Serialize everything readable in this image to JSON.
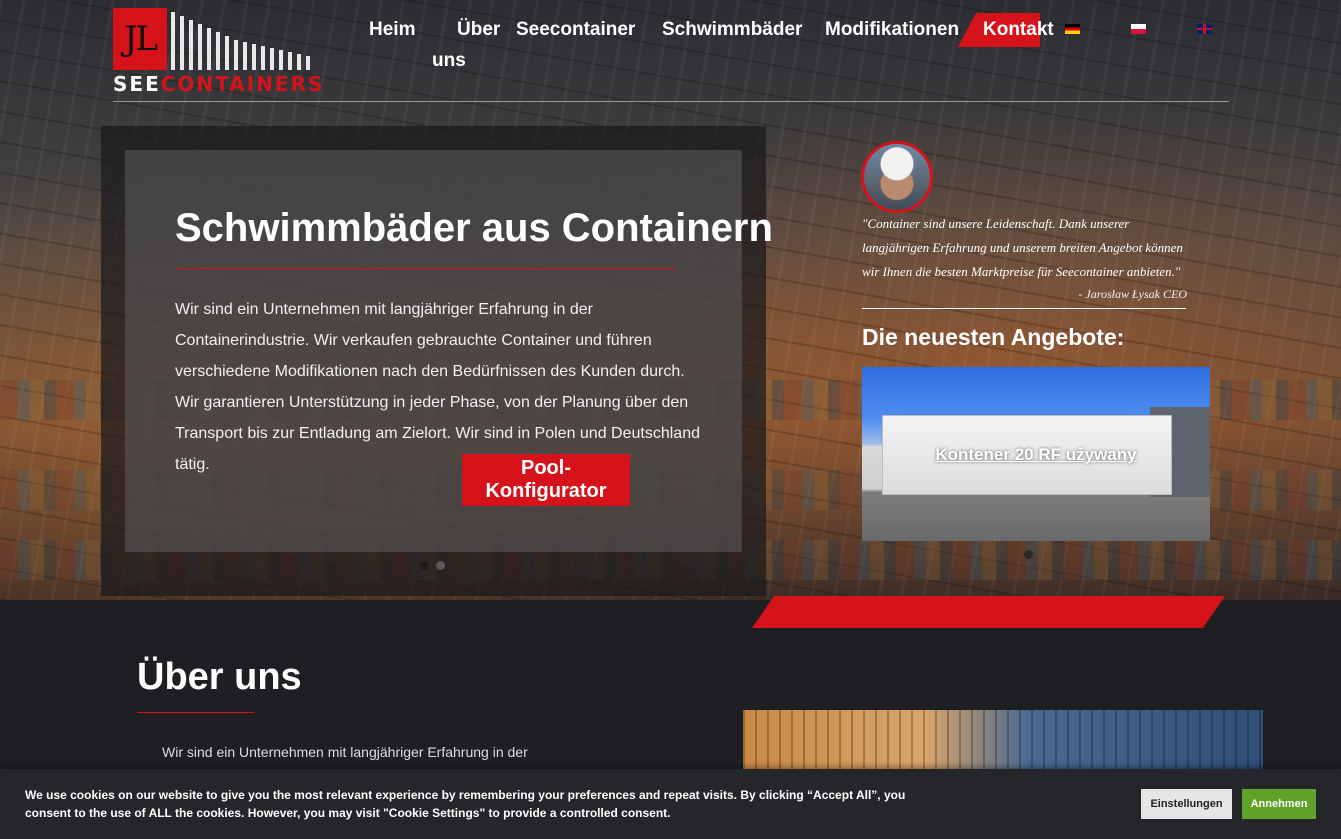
{
  "brand": {
    "logo_monogram": "JL",
    "logo_word_1": "SEE",
    "logo_word_2": "CONTAINERS",
    "accent_color": "#d6121b"
  },
  "nav": {
    "items": [
      {
        "label": "Heim"
      },
      {
        "label": "Über"
      },
      {
        "label": "uns"
      },
      {
        "label": "Seecontainer"
      },
      {
        "label": "Schwimmbäder"
      },
      {
        "label": "Modifikationen"
      },
      {
        "label": "Kontakt"
      }
    ],
    "flags": [
      "flag-de-icon",
      "flag-pl-icon",
      "flag-en-icon"
    ]
  },
  "slider": {
    "title": "Schwimmbäder aus Containern",
    "text": "Wir sind ein Unternehmen mit langjähriger Erfahrung in der Containerindustrie. Wir verkaufen gebrauchte Container und führen verschiedene Modifikationen nach den Bedürfnissen des Kunden durch. Wir garantieren Unterstützung in jeder Phase, von der Planung über den Transport bis zur Entladung am Zielort. Wir sind in Polen und Deutschland tätig.",
    "button_label": "Pool-Konfigurator",
    "slide_count": 2,
    "active_slide": 1
  },
  "testimonial": {
    "quote": "\"Container sind unsere Leidenschaft. Dank unserer langjährigen Erfahrung und unserem breiten Angebot können wir Ihnen die besten Marktpreise für Seecontainer anbieten.\"",
    "author": "- Jarosław Łysak CEO"
  },
  "offers": {
    "title": "Die neuesten Angebote:",
    "items": [
      {
        "label": "Kontener 20 RF używany"
      }
    ]
  },
  "about": {
    "title": "Über uns",
    "text": "Wir sind ein Unternehmen mit langjähriger Erfahrung in der Containerindustrie. Wir"
  },
  "cookie": {
    "text": "We use cookies on our website to give you the most relevant experience by remembering your preferences and repeat visits. By clicking “Accept All”, you consent to the use of ALL the cookies. However, you may visit \"Cookie Settings\" to provide a controlled consent.",
    "settings_label": "Einstellungen",
    "accept_label": "Annehmen",
    "accept_color": "#61a229"
  }
}
